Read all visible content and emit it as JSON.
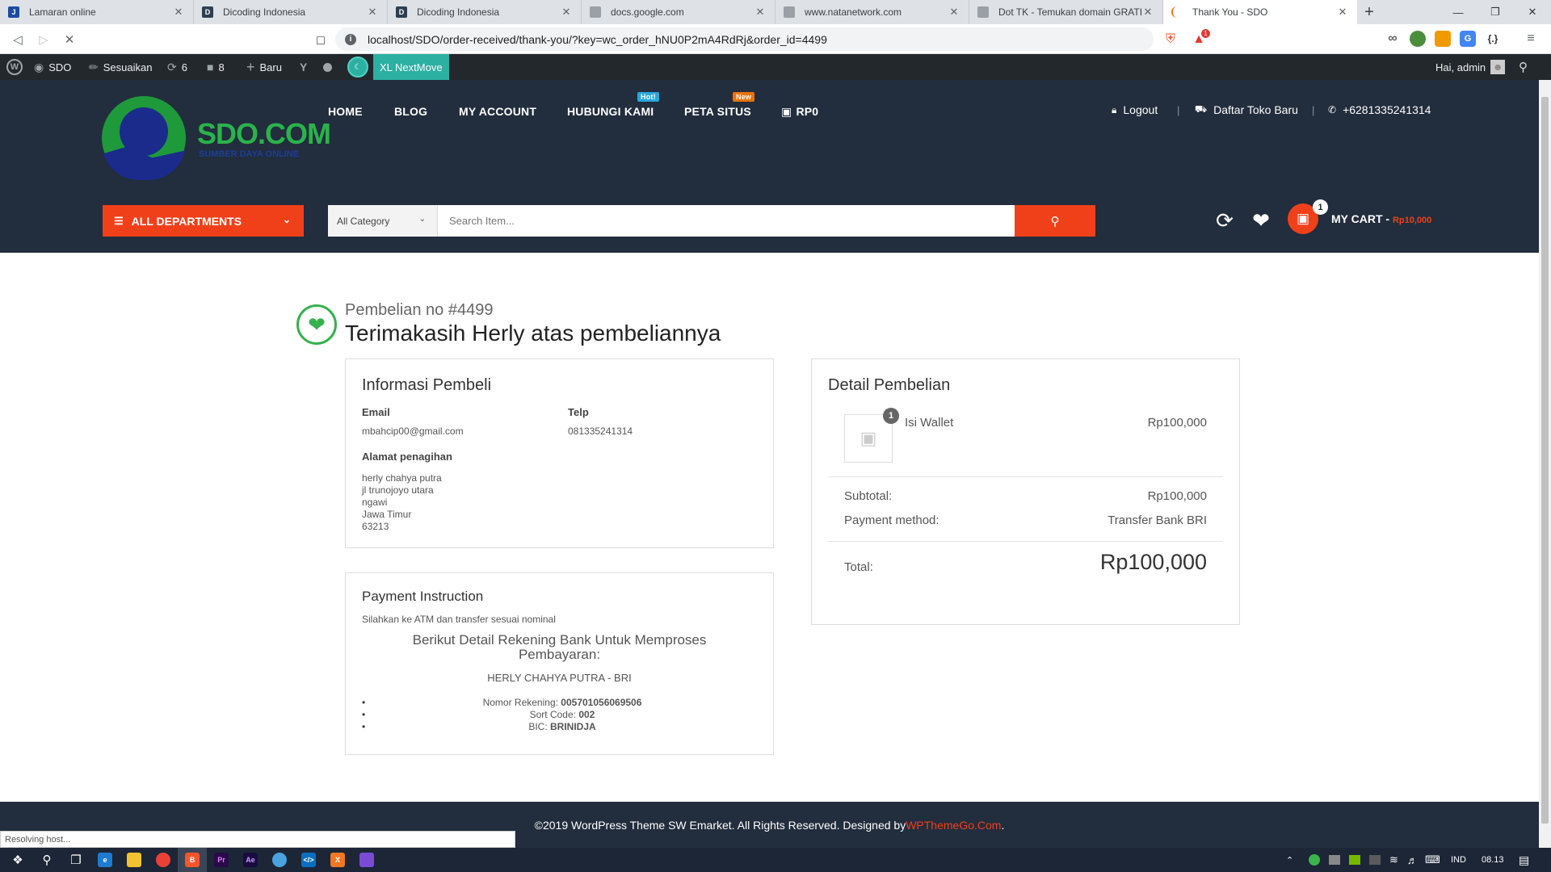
{
  "browser": {
    "tabs": [
      {
        "title": "Lamaran online",
        "icon": "jobstreet-favicon",
        "color": "#1b4ba1",
        "glyph": "J",
        "active": false
      },
      {
        "title": "Dicoding Indonesia",
        "icon": "dicoding-favicon",
        "color": "#2d3e50",
        "glyph": "D",
        "active": false
      },
      {
        "title": "Dicoding Indonesia",
        "icon": "dicoding-favicon",
        "color": "#2d3e50",
        "glyph": "D",
        "active": false
      },
      {
        "title": "docs.google.com",
        "icon": "document-favicon",
        "color": "#9aa0a6",
        "glyph": "",
        "active": false
      },
      {
        "title": "www.natanetwork.com",
        "icon": "globe-favicon",
        "color": "#9aa0a6",
        "glyph": "",
        "active": false
      },
      {
        "title": "Dot TK - Temukan domain GRATIS",
        "icon": "globe-favicon",
        "color": "#9aa0a6",
        "glyph": "",
        "active": false
      },
      {
        "title": "Thank You - SDO",
        "icon": "loading-favicon",
        "color": "#e8710a",
        "glyph": "",
        "active": true
      }
    ],
    "url": "localhost/SDO/order-received/thank-you/?key=wc_order_hNU0P2mA4RdRj&order_id=4499",
    "brave_badge": "1"
  },
  "wp_admin": {
    "site": "SDO",
    "customize": "Sesuaikan",
    "updates": "6",
    "comments": "8",
    "new": "Baru",
    "xl": "XL NextMove",
    "greeting": "Hai, admin"
  },
  "site": {
    "logo_name": "SDO.COM",
    "logo_tagline": "SUMBER DAYA ONLINE",
    "menu": [
      {
        "label": "HOME",
        "badge": "",
        "badge_color": ""
      },
      {
        "label": "BLOG",
        "badge": "",
        "badge_color": ""
      },
      {
        "label": "MY ACCOUNT",
        "badge": "",
        "badge_color": ""
      },
      {
        "label": "HUBUNGI KAMI",
        "badge": "Hot!",
        "badge_color": "#2aa5dc"
      },
      {
        "label": "PETA SITUS",
        "badge": "New",
        "badge_color": "#e8730c"
      },
      {
        "label": "RP0",
        "badge": "",
        "badge_color": ""
      }
    ],
    "top_links": {
      "logout": "Logout",
      "store": "Daftar Toko Baru",
      "phone": "+6281335241314"
    },
    "departments": "ALL DEPARTMENTS",
    "category": "All Category",
    "search_placeholder": "Search Item...",
    "cart_count": "1",
    "cart_label": "MY CART - ",
    "cart_amount": "Rp10,000",
    "accent_color": "#f0401a",
    "header_color": "#222d3d"
  },
  "order": {
    "order_no": "Pembelian no #4499",
    "thanks": "Terimakasih Herly atas pembeliannya",
    "buyer": {
      "title": "Informasi Pembeli",
      "email_label": "Email",
      "email": "mbahcip00@gmail.com",
      "phone_label": "Telp",
      "phone": "081335241314",
      "address_label": "Alamat penagihan",
      "address": [
        "herly chahya putra",
        "jl trunojoyo utara",
        "ngawi",
        "Jawa Timur",
        "63213"
      ]
    },
    "payment": {
      "title": "Payment Instruction",
      "note": "Silahkan ke ATM dan transfer sesuai nominal",
      "heading_line1": "Berikut Detail Rekening Bank Untuk Memproses",
      "heading_line2": "Pembayaran:",
      "account_name": "HERLY CHAHYA PUTRA - BRI",
      "details": [
        {
          "label": "Nomor Rekening: ",
          "value": "005701056069506"
        },
        {
          "label": "Sort Code: ",
          "value": "002"
        },
        {
          "label": "BIC: ",
          "value": "BRINIDJA"
        }
      ]
    },
    "detail": {
      "title": "Detail Pembelian",
      "product": "Isi Wallet",
      "quantity": "1",
      "price": "Rp100,000",
      "subtotal_label": "Subtotal:",
      "subtotal": "Rp100,000",
      "method_label": "Payment method:",
      "method": "Transfer Bank BRI",
      "total_label": "Total:",
      "total": "Rp100,000"
    }
  },
  "footer": {
    "text": "©2019 WordPress Theme SW Emarket. All Rights Reserved. Designed by ",
    "link": "WPThemeGo.Com",
    "end": "."
  },
  "status": "Resolving host...",
  "taskbar": {
    "language": "IND",
    "time": "08.13"
  }
}
